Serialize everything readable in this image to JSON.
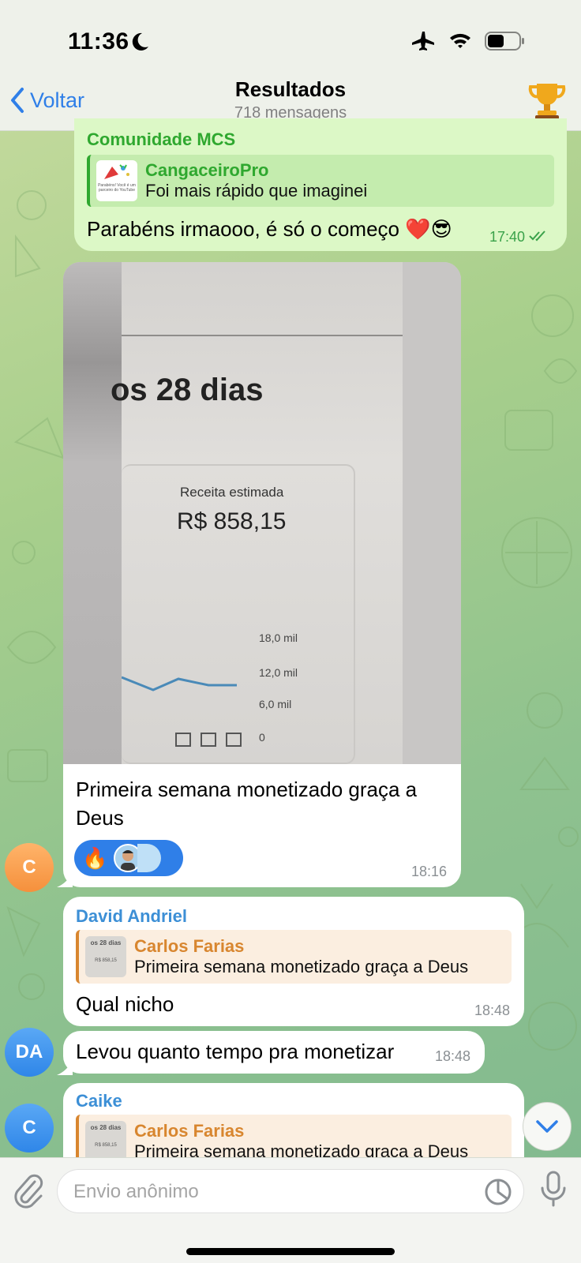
{
  "status": {
    "time": "11:36"
  },
  "nav": {
    "back_label": "Voltar",
    "title": "Resultados",
    "subtitle": "718 mensagens"
  },
  "messages": {
    "m1": {
      "sender": "Comunidade MCS",
      "reply_title": "CangaceiroPro",
      "reply_text": "Foi mais rápido que imaginei",
      "reply_thumb_text": "Parabéns! Você é um parceiro do YouTube",
      "text": "Parabéns irmaooo, é só o começo ❤️😎",
      "time": "17:40"
    },
    "m2": {
      "photo_heading": "os 28 dias",
      "photo_label": "Receita estimada",
      "photo_value": "R$ 858,15",
      "photo_ticks": [
        "18,0 mil",
        "12,0 mil",
        "6,0 mil",
        "0"
      ],
      "text": "Primeira semana monetizado graça a Deus",
      "reaction_emoji": "🔥",
      "time": "18:16",
      "avatar": "C"
    },
    "m3": {
      "sender": "David Andriel",
      "reply_title": "Carlos Farias",
      "reply_text": "Primeira semana monetizado graça a Deus",
      "reply_thumb_heading": "os 28 dias",
      "reply_thumb_value": "R$ 858,15",
      "text": "Qual nicho",
      "time": "18:48"
    },
    "m4": {
      "text": "Levou quanto tempo pra monetizar",
      "time": "18:48",
      "avatar": "DA"
    },
    "m5": {
      "sender": "Caike",
      "reply_title": "Carlos Farias",
      "reply_text": "Primeira semana monetizado graça a Deus",
      "reply_thumb_heading": "os 28 dias",
      "reply_thumb_value": "R$ 858,15",
      "avatar": "C"
    }
  },
  "input": {
    "placeholder": "Envio anônimo"
  },
  "colors": {
    "accent": "#2f7fe8",
    "community_green": "#2fa82f",
    "sender_blue": "#3c8fd6",
    "reply_orange": "#d8862f",
    "out_bubble": "#dcf8c6"
  }
}
